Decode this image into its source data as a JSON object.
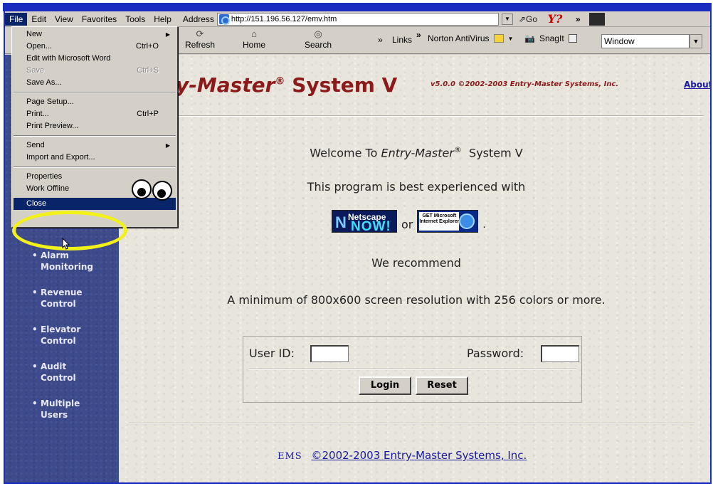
{
  "menubar": {
    "items": [
      {
        "key": "F",
        "rest": "ile",
        "active": true
      },
      {
        "key": "E",
        "rest": "dit"
      },
      {
        "key": "V",
        "rest": "iew"
      },
      {
        "key": "a",
        "rest": "Favorites",
        "pre": "F"
      },
      {
        "key": "T",
        "rest": "ools"
      },
      {
        "key": "H",
        "rest": "elp"
      }
    ],
    "labels": [
      "File",
      "Edit",
      "View",
      "Favorites",
      "Tools",
      "Help"
    ]
  },
  "address": {
    "label": "Address",
    "url": "http://151.196.56.127/emv.htm",
    "go_label": "Go",
    "yahoo": "Y?",
    "chevron": "»"
  },
  "toolbar": {
    "refresh": "Refresh",
    "home": "Home",
    "search": "Search",
    "links": "Links",
    "norton": "Norton AntiVirus",
    "snagit": "SnagIt",
    "window_value": "Window"
  },
  "file_menu": {
    "new": "New",
    "open": "Open...",
    "open_sc": "Ctrl+O",
    "edit_word": "Edit with Microsoft Word",
    "save": "Save",
    "save_sc": "Ctrl+S",
    "save_as": "Save As...",
    "page_setup": "Page Setup...",
    "print": "Print...",
    "print_sc": "Ctrl+P",
    "print_preview": "Print Preview...",
    "send": "Send",
    "import_export": "Import and Export...",
    "properties": "Properties",
    "work_offline": "Work Offline",
    "close": "Close"
  },
  "page": {
    "title_italic": "y-Master",
    "title_reg": "®",
    "title_system": "System V",
    "version": "v5.0.0 ©2002-2003 Entry-Master Systems, Inc.",
    "about": "About",
    "welcome_pre": "Welcome To ",
    "welcome_brand": "Entry-Master",
    "welcome_reg": "®",
    "welcome_post": "System V",
    "best_experienced": "This program is best experienced with",
    "netscape_top": "Netscape",
    "netscape_now": "NOW!",
    "or": "or",
    "ie_text": "GET Microsoft Internet Explorer",
    "period": ".",
    "recommend": "We recommend",
    "resolution": "A minimum of 800x600 screen resolution with 256 colors or more.",
    "user_id_label": "User ID:",
    "password_label": "Password:",
    "login": "Login",
    "reset": "Reset",
    "footer_logo": "EMS",
    "footer_link": "©2002-2003 Entry-Master Systems, Inc."
  },
  "left_nav": {
    "items": [
      {
        "line1": "Alarm",
        "line2": "Monitoring"
      },
      {
        "line1": "Revenue",
        "line2": "Control"
      },
      {
        "line1": "Elevator",
        "line2": "Control"
      },
      {
        "line1": "Audit",
        "line2": "Control"
      },
      {
        "line1": "Multiple",
        "line2": "Users"
      }
    ],
    "bullet": "•"
  },
  "colors": {
    "title_red": "#8b1a1a",
    "link_blue": "#1a1aa0",
    "nav_bg": "#3d4a8c",
    "highlight_ring": "#f2f21a",
    "menu_highlight": "#0a246a"
  }
}
